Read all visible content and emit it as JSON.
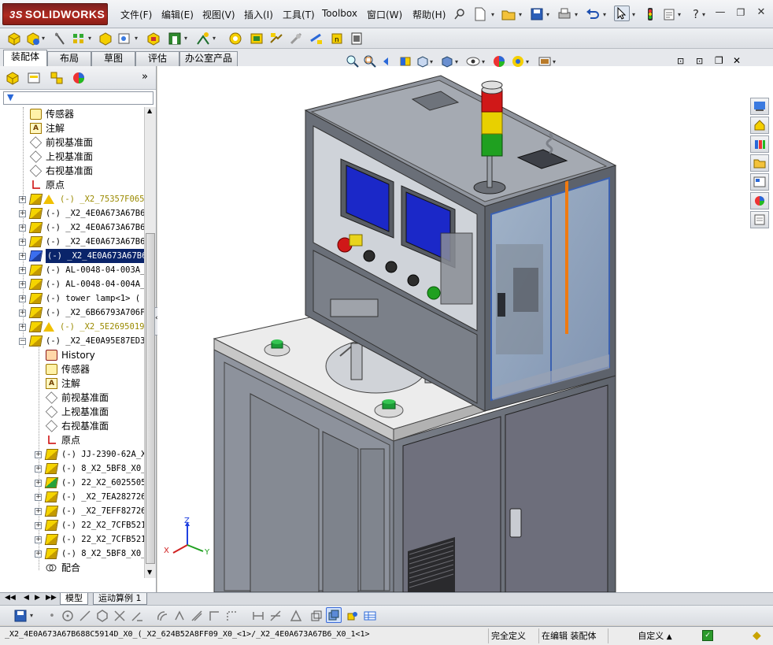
{
  "app": {
    "logo_text": "SOLIDWORKS",
    "logo_prefix": "3S"
  },
  "menu": [
    {
      "label": "文件(F)"
    },
    {
      "label": "编辑(E)"
    },
    {
      "label": "视图(V)"
    },
    {
      "label": "插入(I)"
    },
    {
      "label": "工具(T)"
    },
    {
      "label": "Toolbox"
    },
    {
      "label": "窗口(W)"
    },
    {
      "label": "帮助(H)"
    }
  ],
  "command_tabs": [
    {
      "label": "装配体",
      "active": true
    },
    {
      "label": "布局"
    },
    {
      "label": "草图"
    },
    {
      "label": "评估"
    },
    {
      "label": "办公室产品"
    }
  ],
  "tree": [
    {
      "label": "传感器",
      "icon": "sensor",
      "depth": 1
    },
    {
      "label": "注解",
      "icon": "annotation",
      "depth": 1
    },
    {
      "label": "前视基准面",
      "icon": "plane",
      "depth": 1
    },
    {
      "label": "上视基准面",
      "icon": "plane",
      "depth": 1
    },
    {
      "label": "右视基准面",
      "icon": "plane",
      "depth": 1
    },
    {
      "label": "原点",
      "icon": "origin",
      "depth": 1
    },
    {
      "label": "(-) _X2_75357F065",
      "icon": "part-warning",
      "depth": 1,
      "expand": true,
      "warning": true
    },
    {
      "label": "(-) _X2_4E0A673A67B6",
      "icon": "part",
      "depth": 1,
      "expand": true
    },
    {
      "label": "(-) _X2_4E0A673A67B6",
      "icon": "part",
      "depth": 1,
      "expand": true
    },
    {
      "label": "(-) _X2_4E0A673A67B6",
      "icon": "part",
      "depth": 1,
      "expand": true
    },
    {
      "label": "(-) _X2_4E0A673A67B6",
      "icon": "part-blue",
      "depth": 1,
      "expand": true,
      "selected": true
    },
    {
      "label": "(-) AL-0048-04-003A_",
      "icon": "part",
      "depth": 1,
      "expand": true
    },
    {
      "label": "(-) AL-0048-04-004A_",
      "icon": "part",
      "depth": 1,
      "expand": true
    },
    {
      "label": "(-) tower lamp<1> (",
      "icon": "part",
      "depth": 1,
      "expand": true
    },
    {
      "label": "(-) _X2_6B66793A706F",
      "icon": "part",
      "depth": 1,
      "expand": true
    },
    {
      "label": "(-) _X2_5E2695019",
      "icon": "part-warning",
      "depth": 1,
      "expand": true,
      "warning": true
    },
    {
      "label": "(-) _X2_4E0A95E87ED3",
      "icon": "part",
      "depth": 1,
      "expand": true,
      "open": true
    },
    {
      "label": "History",
      "icon": "history",
      "depth": 2
    },
    {
      "label": "传感器",
      "icon": "sensor",
      "depth": 2
    },
    {
      "label": "注解",
      "icon": "annotation",
      "depth": 2
    },
    {
      "label": "前视基准面",
      "icon": "plane",
      "depth": 2
    },
    {
      "label": "上视基准面",
      "icon": "plane",
      "depth": 2
    },
    {
      "label": "右视基准面",
      "icon": "plane",
      "depth": 2
    },
    {
      "label": "原点",
      "icon": "origin",
      "depth": 2
    },
    {
      "label": "(-) JJ-2390-62A_X",
      "icon": "part",
      "depth": 2,
      "expand": true
    },
    {
      "label": "(-) 8_X2_5BF8_X0_",
      "icon": "part",
      "depth": 2,
      "expand": true
    },
    {
      "label": "(-) 22_X2_6025505",
      "icon": "part-green",
      "depth": 2,
      "expand": true
    },
    {
      "label": "(-) _X2_7EA282726",
      "icon": "part",
      "depth": 2,
      "expand": true
    },
    {
      "label": "(-) _X2_7EFF82726",
      "icon": "part",
      "depth": 2,
      "expand": true
    },
    {
      "label": "(-) 22_X2_7CFB521",
      "icon": "part",
      "depth": 2,
      "expand": true
    },
    {
      "label": "(-) 22_X2_7CFB521",
      "icon": "part",
      "depth": 2,
      "expand": true
    },
    {
      "label": "(-) 8_X2_5BF8_X0_",
      "icon": "part",
      "depth": 2,
      "expand": true
    },
    {
      "label": "配合",
      "icon": "mates",
      "depth": 2
    }
  ],
  "bottom_tabs": [
    {
      "label": "模型",
      "active": true
    },
    {
      "label": "运动算例 1"
    }
  ],
  "triad": {
    "x": "X",
    "y": "Y",
    "z": "Z"
  },
  "status": {
    "path": "_X2_4E0A673A67B688C5914D_X0_(_X2_624B52A8FF09_X0_<1>/_X2_4E0A673A67B6_X0_1<1>",
    "defined": "完全定义",
    "mode": "在编辑 装配体",
    "units": "自定义"
  },
  "colors": {
    "accent_blue": "#0a246a",
    "frame_gray": "#6b7079",
    "panel_gray": "#8a8f98",
    "screen_blue": "#1b28c8",
    "lamp_red": "#d01818",
    "lamp_yellow": "#e8d000",
    "lamp_green": "#1fa020",
    "orange_rod": "#f07a10"
  }
}
